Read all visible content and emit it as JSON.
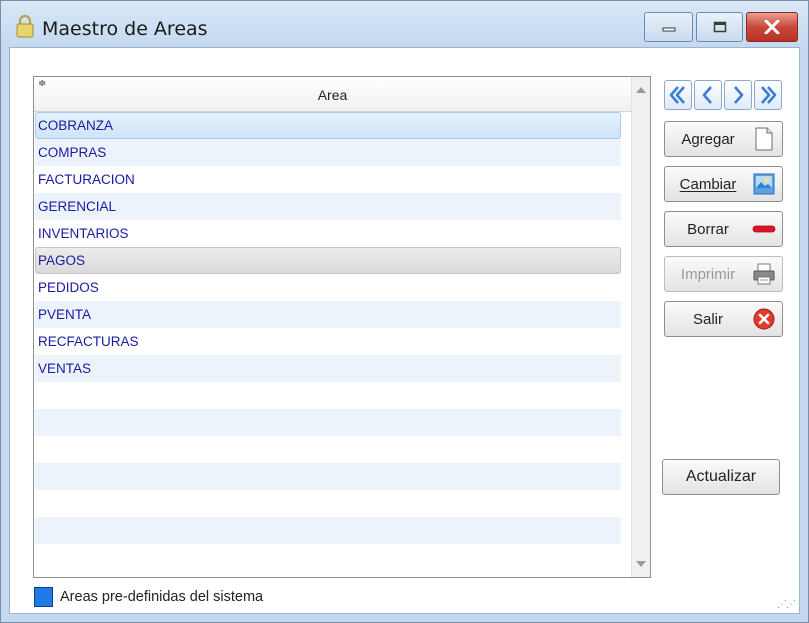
{
  "window": {
    "title": "Maestro de Areas"
  },
  "grid": {
    "header": "Area",
    "sort_glyph": "≑",
    "rows": [
      {
        "label": "COBRANZA",
        "state": "selected"
      },
      {
        "label": "COMPRAS",
        "state": "alt"
      },
      {
        "label": "FACTURACION",
        "state": "normal"
      },
      {
        "label": "GERENCIAL",
        "state": "alt"
      },
      {
        "label": "INVENTARIOS",
        "state": "normal"
      },
      {
        "label": "PAGOS",
        "state": "hover"
      },
      {
        "label": "PEDIDOS",
        "state": "normal"
      },
      {
        "label": "PVENTA",
        "state": "alt"
      },
      {
        "label": "RECFACTURAS",
        "state": "normal"
      },
      {
        "label": "VENTAS",
        "state": "alt"
      },
      {
        "label": "",
        "state": "normal"
      },
      {
        "label": "",
        "state": "alt"
      },
      {
        "label": "",
        "state": "normal"
      },
      {
        "label": "",
        "state": "alt"
      },
      {
        "label": "",
        "state": "normal"
      },
      {
        "label": "",
        "state": "alt"
      },
      {
        "label": "",
        "state": "normal"
      }
    ]
  },
  "nav": {
    "icons": [
      "first-record-icon",
      "previous-record-icon",
      "next-record-icon",
      "last-record-icon"
    ]
  },
  "actions": {
    "agregar": {
      "label": "Agregar",
      "icon": "new-document-icon"
    },
    "cambiar": {
      "label": "Cambiar",
      "icon": "edit-picture-icon"
    },
    "borrar": {
      "label": "Borrar",
      "icon": "remove-icon"
    },
    "imprimir": {
      "label": "Imprimir",
      "icon": "printer-icon",
      "enabled": false
    },
    "salir": {
      "label": "Salir",
      "icon": "exit-x-icon"
    },
    "actualizar": {
      "label": "Actualizar"
    }
  },
  "legend": {
    "text": "Areas pre-definidas del sistema",
    "swatch_color": "#1f7ae8"
  },
  "colors": {
    "row_text": "#1a1aa0",
    "alt_row": "#edf3fb",
    "titlebar": "#c4d9f0",
    "close_button": "#c9483a"
  }
}
